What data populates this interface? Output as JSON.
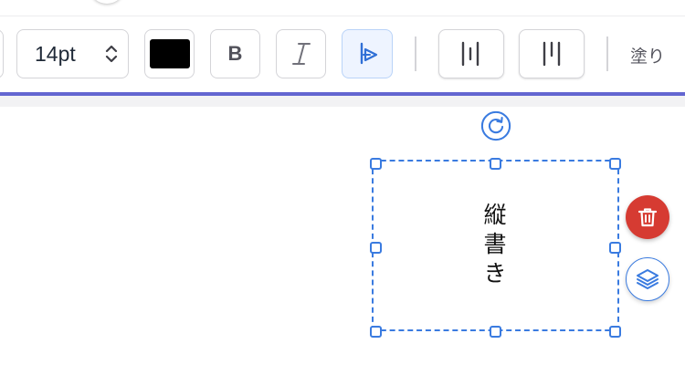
{
  "toolbar": {
    "font_size": "14pt",
    "text_color": "#000000",
    "bold_label": "B",
    "fill_label": "塗り"
  },
  "text_box": {
    "content": "縦書き",
    "orientation": "vertical"
  },
  "colors": {
    "accent": "#6366d1",
    "selection": "#3a7be0",
    "delete": "#d63b32",
    "active_button_bg": "#eef4ff"
  },
  "icons": {
    "rotate": "rotate-icon",
    "delete": "trash-icon",
    "layers": "layers-icon",
    "italic": "italic-icon",
    "vertical_text": "vertical-text-icon",
    "align_a": "align-columns-icon",
    "align_b": "align-columns-narrow-icon",
    "stepper": "chevron-up-down-icon"
  }
}
